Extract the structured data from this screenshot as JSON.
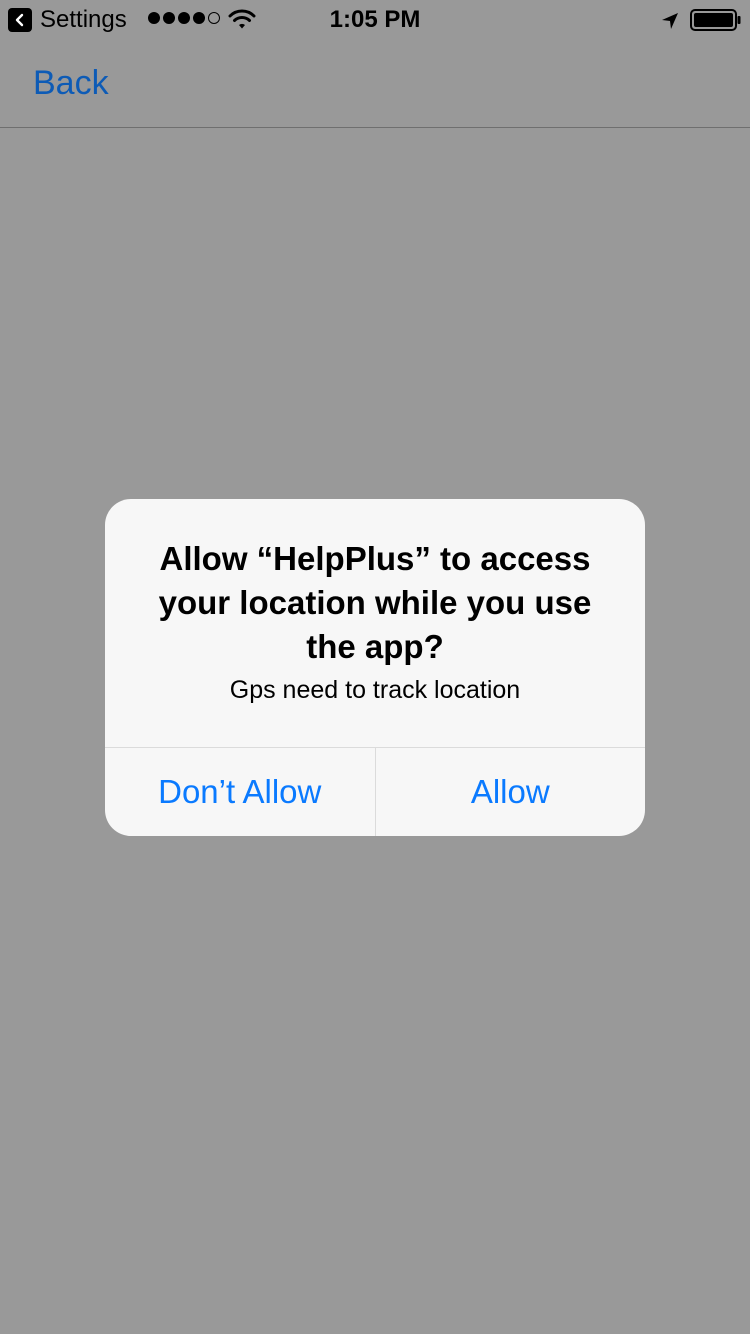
{
  "status_bar": {
    "back_app_label": "Settings",
    "time": "1:05 PM",
    "signal_bars": 4,
    "signal_total": 5
  },
  "nav": {
    "back_label": "Back"
  },
  "alert": {
    "title": "Allow “HelpPlus” to access your location while you use the app?",
    "message": "Gps need to track location",
    "buttons": {
      "dont_allow": "Don’t Allow",
      "allow": "Allow"
    }
  },
  "colors": {
    "dim_background": "#999999",
    "alert_background": "#f7f7f7",
    "action_blue": "#0a7aff",
    "nav_back_blue": "#0d5bb6"
  }
}
